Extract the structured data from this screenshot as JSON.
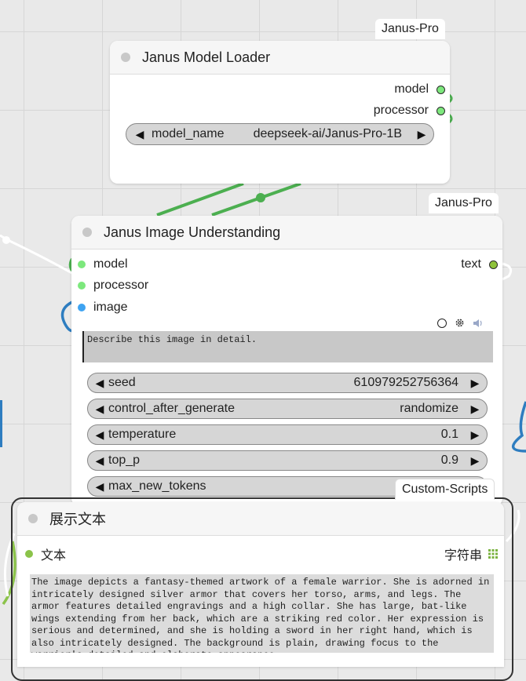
{
  "loader": {
    "badge": "Janus-Pro",
    "title": "Janus Model Loader",
    "outputs": [
      "model",
      "processor"
    ],
    "widget": {
      "label": "model_name",
      "value": "deepseek-ai/Janus-Pro-1B"
    }
  },
  "understanding": {
    "badge": "Janus-Pro",
    "title": "Janus Image Understanding",
    "inputs": [
      "model",
      "processor",
      "image"
    ],
    "output": "text",
    "prompt": "Describe this image in detail.",
    "widgets": [
      {
        "label": "seed",
        "value": "610979252756364"
      },
      {
        "label": "control_after_generate",
        "value": "randomize"
      },
      {
        "label": "temperature",
        "value": "0.1"
      },
      {
        "label": "top_p",
        "value": "0.9"
      },
      {
        "label": "max_new_tokens",
        "value": ""
      }
    ]
  },
  "display": {
    "badge": "Custom-Scripts",
    "title": "展示文本",
    "input": "文本",
    "output": "字符串",
    "text": "The image depicts a fantasy-themed artwork of a female warrior. She is adorned in intricately designed silver armor that covers her torso, arms, and legs. The armor features detailed engravings and a high collar. She has large, bat-like wings extending from her back, which are a striking red color. Her expression is serious and determined, and she is holding a sword in her right hand, which is also intricately designed. The background is plain, drawing focus to the warrior's detailed and elaborate appearance."
  },
  "colors": {
    "wire_green": "#4caf50",
    "wire_blue": "#2e7dc0",
    "wire_lime": "#8bc34a",
    "wire_white": "#ffffff"
  },
  "icons": [
    "circle-icon",
    "gear-icon",
    "speaker-icon",
    "grid-icon"
  ]
}
